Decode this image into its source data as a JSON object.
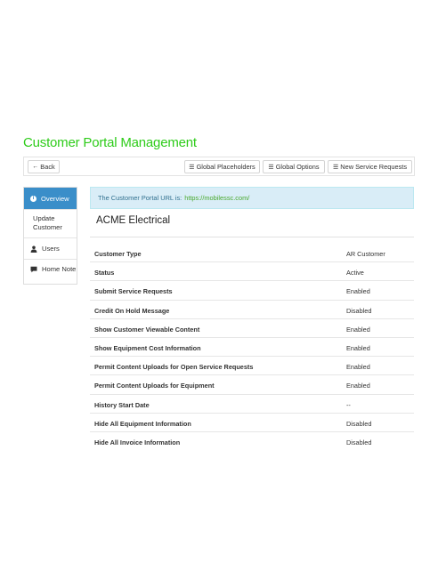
{
  "page": {
    "title": "Customer Portal Management"
  },
  "toolbar": {
    "back_label": "Back",
    "global_placeholders_label": "Global Placeholders",
    "global_options_label": "Global Options",
    "new_service_requests_label": "New Service Requests"
  },
  "sidebar": {
    "items": [
      {
        "label": "Overview",
        "icon": "info-circle-icon",
        "active": true
      },
      {
        "label": "Update Customer",
        "icon": "",
        "active": false
      },
      {
        "label": "Users",
        "icon": "user-icon",
        "active": false
      },
      {
        "label": "Home Note",
        "icon": "comment-icon",
        "active": false
      }
    ]
  },
  "alert": {
    "text": "The Customer Portal URL is:",
    "url": "https://mobilessc.com/"
  },
  "customer": {
    "name": "ACME Electrical"
  },
  "details": [
    {
      "label": "Customer Type",
      "value": "AR Customer"
    },
    {
      "label": "Status",
      "value": "Active"
    },
    {
      "label": "Submit Service Requests",
      "value": "Enabled"
    },
    {
      "label": "Credit On Hold Message",
      "value": "Disabled"
    },
    {
      "label": "Show Customer Viewable Content",
      "value": "Enabled"
    },
    {
      "label": "Show Equipment Cost Information",
      "value": "Enabled"
    },
    {
      "label": "Permit Content Uploads for Open Service Requests",
      "value": "Enabled"
    },
    {
      "label": "Permit Content Uploads for Equipment",
      "value": "Enabled"
    },
    {
      "label": "History Start Date",
      "value": "--"
    },
    {
      "label": "Hide All Equipment Information",
      "value": "Disabled"
    },
    {
      "label": "Hide All Invoice Information",
      "value": "Disabled"
    }
  ],
  "colors": {
    "title": "#2ecc1a",
    "accent": "#3a8ec9",
    "alert_bg": "#d9edf7",
    "link": "#4aa92f"
  }
}
